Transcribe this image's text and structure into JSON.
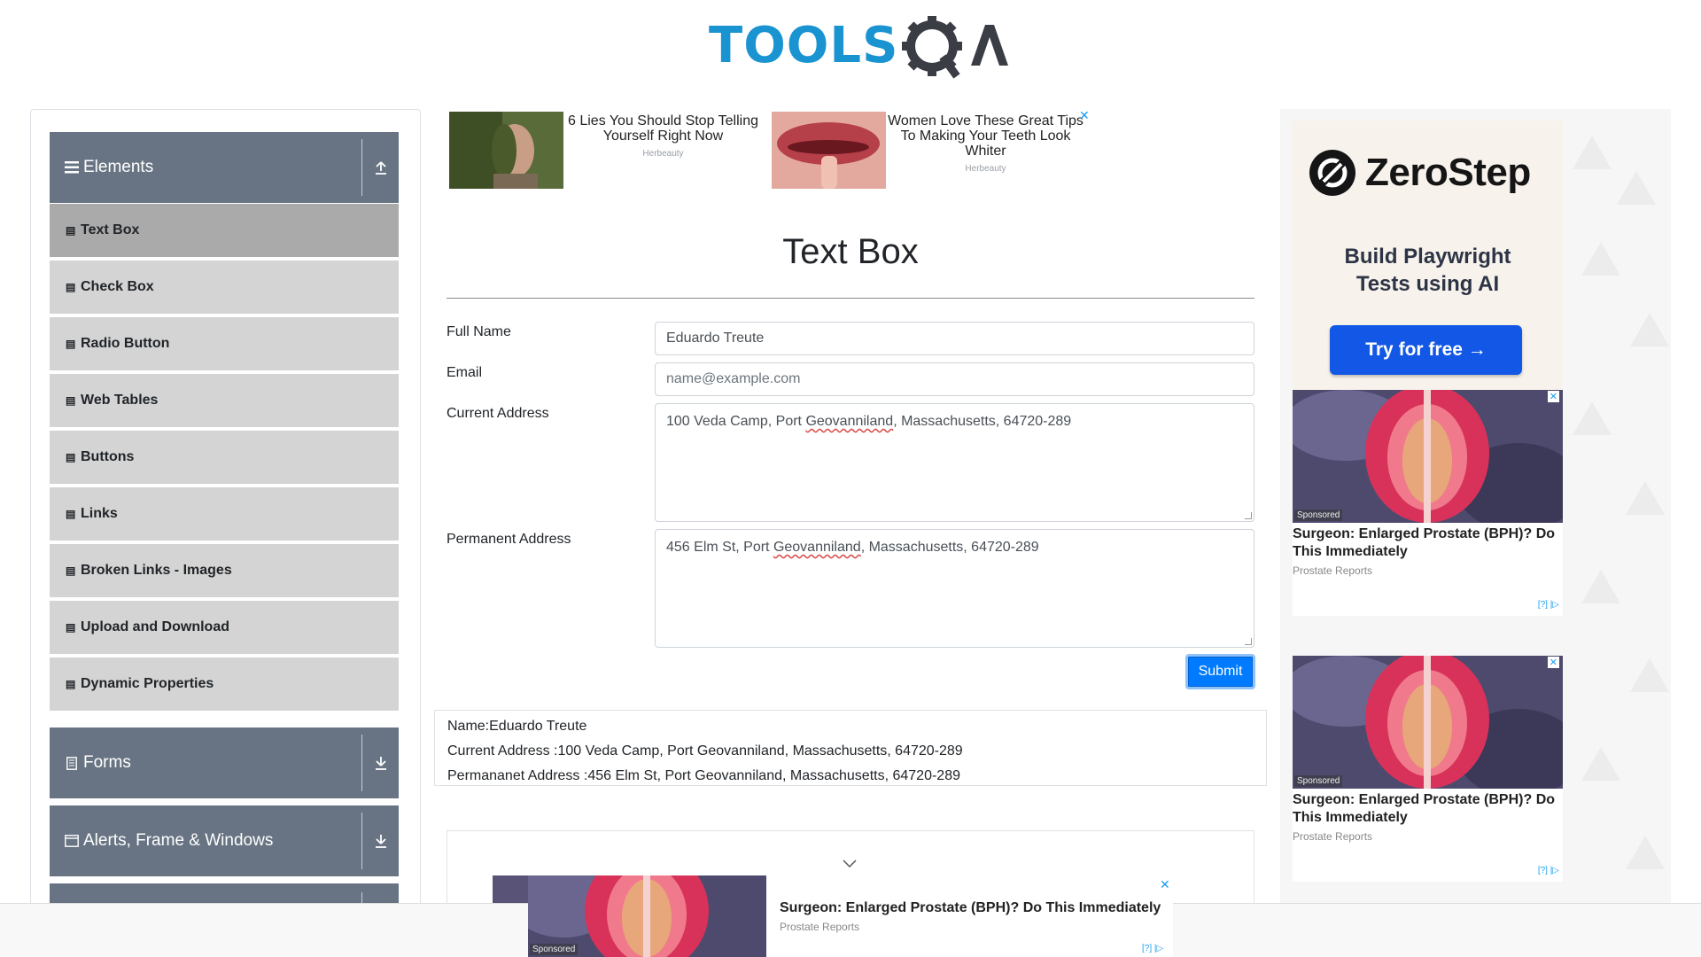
{
  "logo": {
    "text_tools": "TOOLS",
    "text_qa": "QA"
  },
  "sidebar": {
    "groups": [
      {
        "label": "Elements",
        "icon": "hamburger-icon",
        "toggle": "collapse-icon"
      },
      {
        "label": "Forms",
        "icon": "form-icon",
        "toggle": "expand-icon"
      },
      {
        "label": "Alerts, Frame & Windows",
        "icon": "window-icon",
        "toggle": "expand-icon"
      }
    ],
    "items": [
      "Text Box",
      "Check Box",
      "Radio Button",
      "Web Tables",
      "Buttons",
      "Links",
      "Broken Links - Images",
      "Upload and Download",
      "Dynamic Properties"
    ],
    "active_item": "Text Box"
  },
  "top_ads": [
    {
      "title": "6 Lies You Should Stop Telling Yourself Right Now",
      "source": "Herbeauty"
    },
    {
      "title": "Women Love These Great Tips To Making Your Teeth Look Whiter",
      "source": "Herbeauty"
    }
  ],
  "main": {
    "title": "Text Box",
    "labels": {
      "full_name": "Full Name",
      "email": "Email",
      "current_address": "Current Address",
      "permanent_address": "Permanent Address"
    },
    "values": {
      "full_name": "Eduardo Treute",
      "email_placeholder": "name@example.com",
      "current_address_pre": "100 Veda Camp, Port ",
      "current_address_err": "Geovanniland",
      "current_address_post": ", Massachusetts, 64720-289",
      "permanent_address_pre": "456 Elm St, Port ",
      "permanent_address_err": "Geovanniland",
      "permanent_address_post": ", Massachusetts, 64720-289"
    },
    "submit_label": "Submit",
    "output": {
      "name": "Name:Eduardo Treute",
      "current": "Current Address :100 Veda Camp, Port Geovanniland, Massachusetts, 64720-289",
      "permanent": "Permananet Address :456 Elm St, Port Geovanniland, Massachusetts, 64720-289"
    }
  },
  "right_ads": {
    "zerostep": {
      "brand": "ZeroStep",
      "tagline_1": "Build Playwright",
      "tagline_2": "Tests using AI",
      "cta": "Try for free →"
    },
    "cards": [
      {
        "badge": "Sponsored",
        "headline": "Surgeon: Enlarged Prostate (BPH)? Do This Immediately",
        "source": "Prostate Reports",
        "adchoice": "[?] |▷"
      },
      {
        "badge": "Sponsored",
        "headline": "Surgeon: Enlarged Prostate (BPH)? Do This Immediately",
        "source": "Prostate Reports",
        "adchoice": "[?] |▷"
      }
    ]
  },
  "sticky_ad": {
    "badge": "Sponsored",
    "headline": "Surgeon: Enlarged Prostate (BPH)? Do This Immediately",
    "source": "Prostate Reports",
    "adchoice": "[?] |▷"
  },
  "colors": {
    "brand_blue": "#1a93d1",
    "sidebar_header": "#687483",
    "menu_bg": "#d4d4d4",
    "menu_active": "#aaaaaa",
    "submit": "#007bff"
  }
}
